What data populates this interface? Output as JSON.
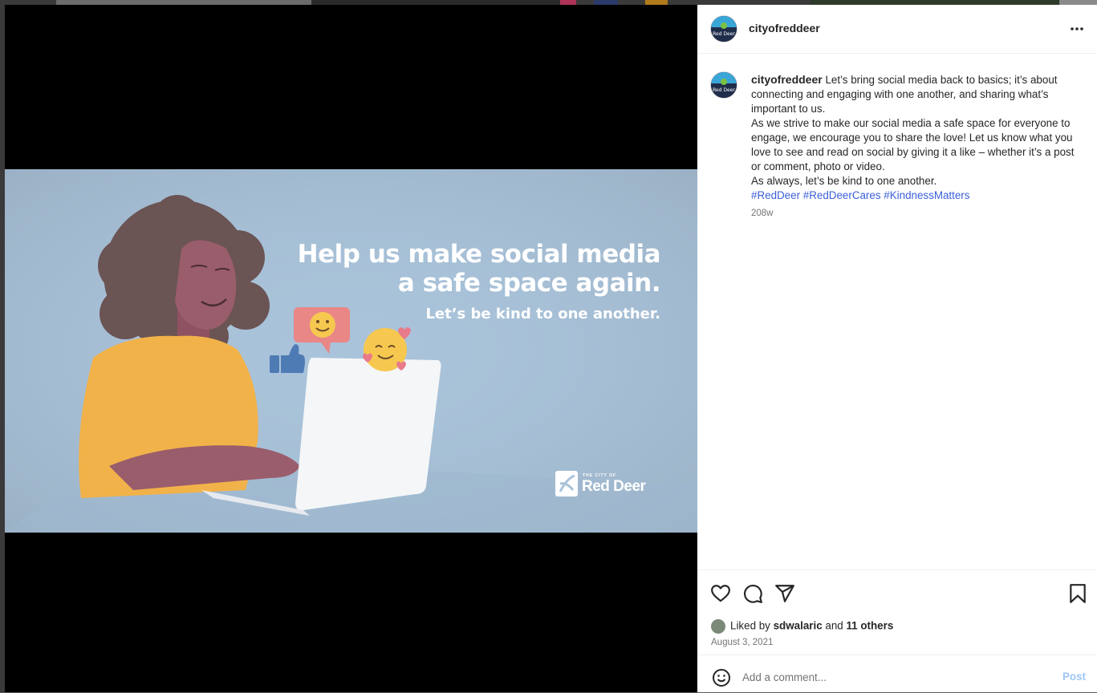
{
  "colors": {
    "image_background": "#a9c3da",
    "sweater": "#f2b24a",
    "skin": "#9a5d6c",
    "hair": "#6b5454",
    "speech_bubble": "#e98686",
    "emoji_yellow": "#f6c84f",
    "thumbs_blue": "#4f7bb5",
    "hashtag_link": "#3a5fd9",
    "post_button": "#9ec5f8"
  },
  "post_image": {
    "headline_line1": "Help us make social media",
    "headline_line2": "a safe space again.",
    "subline": "Let’s be kind to one another.",
    "brand_small": "THE CITY OF",
    "brand_name": "Red Deer"
  },
  "header": {
    "username": "cityofreddeer",
    "more_icon": "more-horizontal-icon"
  },
  "caption": {
    "username": "cityofreddeer",
    "line1": "Let’s bring social media back to basics; it’s about connecting and engaging with one another, and sharing what’s important to us.",
    "line2": "As we strive to make our social media a safe space for everyone to engage, we encourage you to share the love! Let us know what you love to see and read on social by giving it a like – whether it’s a post or comment, photo or video.",
    "line3": "As always, let’s be kind to one another.",
    "hashtags": [
      "#RedDeer",
      "#RedDeerCares",
      "#KindnessMatters"
    ],
    "age": "208w"
  },
  "actions": {
    "like_icon": "heart-icon",
    "comment_icon": "comment-icon",
    "share_icon": "send-icon",
    "save_icon": "bookmark-icon",
    "liked_prefix": "Liked by",
    "liked_user": "sdwalaric",
    "liked_and": "and",
    "liked_others": "11 others",
    "date": "August 3, 2021"
  },
  "comment": {
    "emoji_icon": "emoji-icon",
    "placeholder": "Add a comment...",
    "post_label": "Post"
  }
}
